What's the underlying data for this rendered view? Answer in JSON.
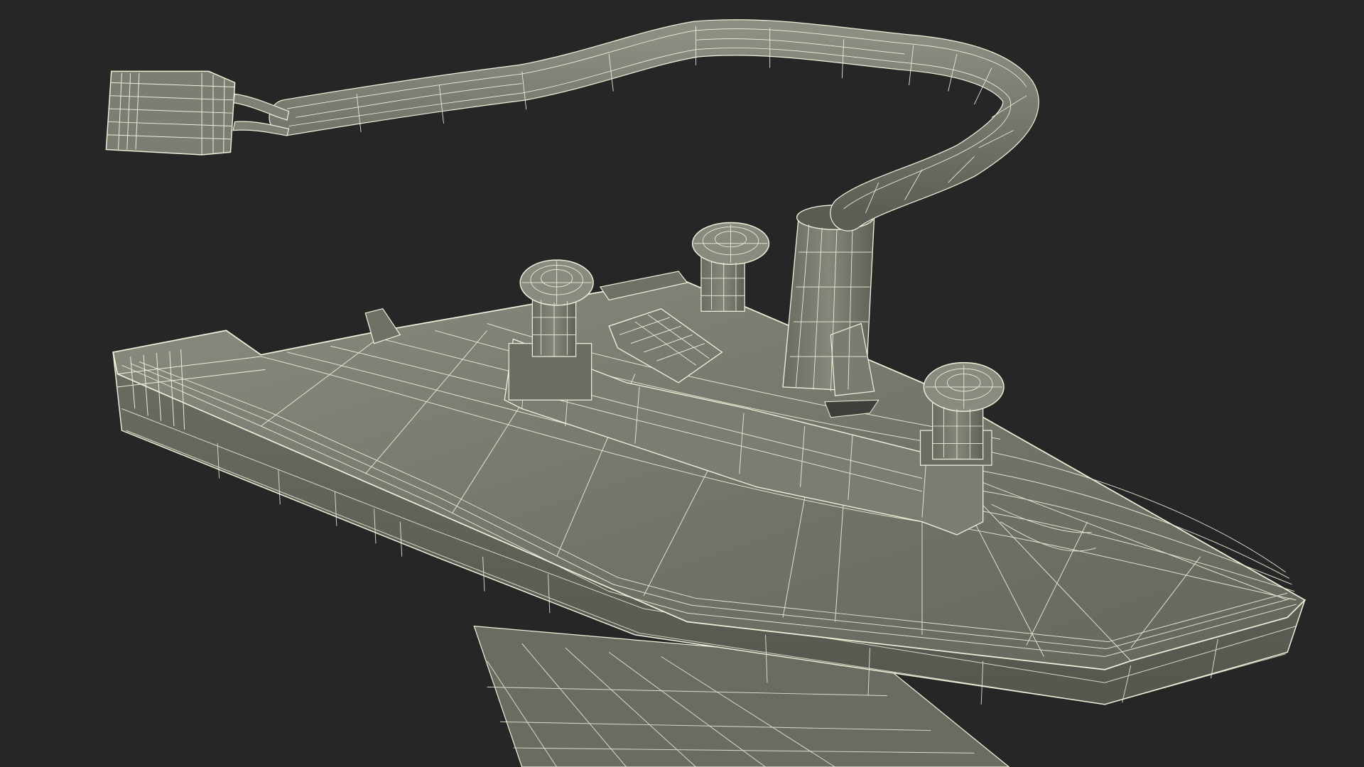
{
  "scene": {
    "subject": "wireframe-render",
    "colors": {
      "background": "#262626",
      "surface_dark": "#5e5f56",
      "surface_mid": "#75766b",
      "surface_light": "#8a8b7f",
      "wire": "#f1efd9",
      "shadow": "#3e3f3a"
    }
  }
}
